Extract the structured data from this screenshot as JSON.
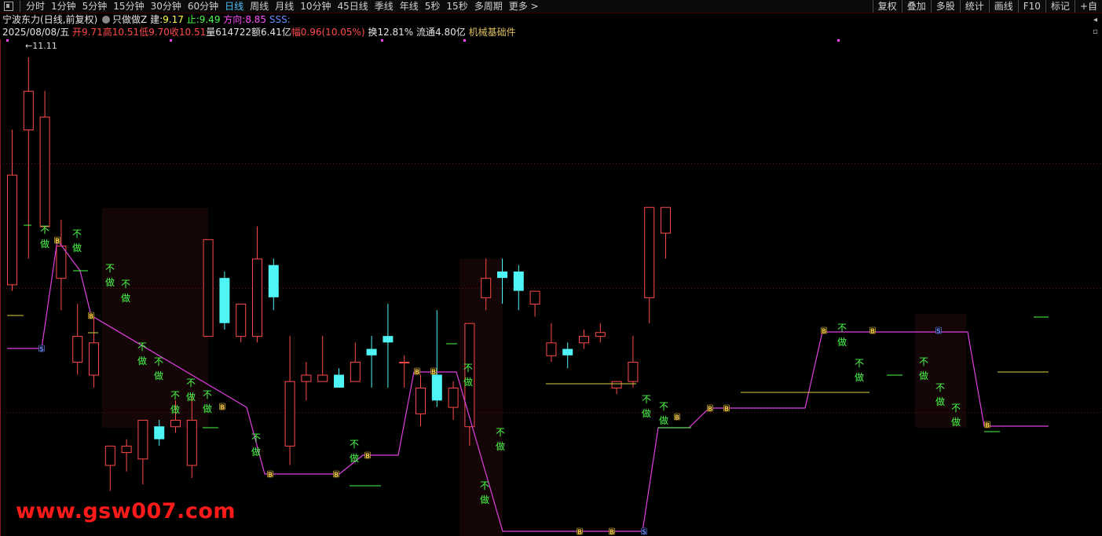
{
  "toolbar": {
    "periods": [
      "分时",
      "1分钟",
      "5分钟",
      "15分钟",
      "30分钟",
      "60分钟",
      "日线",
      "周线",
      "月线",
      "10分钟",
      "45日线",
      "季线",
      "年线",
      "5秒",
      "15秒",
      "多周期",
      "更多 >"
    ],
    "active_period": "日线",
    "right_buttons": [
      "复权",
      "叠加",
      "多股",
      "统计",
      "画线",
      "F10",
      "标记",
      "+自"
    ]
  },
  "info": {
    "stock_name": "宁波东力",
    "mode": "(日线,前复权)",
    "indicator_name": "只做做Z",
    "build_label": "建:",
    "build_value": "9.17",
    "stop_label": "止:",
    "stop_value": "9.49",
    "direction_label": "方向:",
    "direction_value": "8.85",
    "sss": "SSS:"
  },
  "quote": {
    "date": "2025/08/08/五",
    "open": "开9.71",
    "high": "高10.51",
    "low": "低9.70",
    "close": "收10.51",
    "volume": "量614722",
    "amount": "额6.41亿",
    "change": "幅0.96(10.05%)",
    "turnover": "换12.81%",
    "float": "流通4.80亿",
    "sector": "机械基础件"
  },
  "high_label": "11.11",
  "watermark": "www.gsw007.com",
  "signal_text": "不做",
  "signal_b": "B",
  "signal_s": "S",
  "colors": {
    "up": "#ff4a4a",
    "down": "#4ff5f5",
    "signal_green": "#4aff4a",
    "signal_yellow": "#ffd040",
    "trend_magenta": "#e040e0",
    "blue": "#6b8cff",
    "background": "#000000"
  },
  "chart_data": {
    "type": "candlestick",
    "ylim": [
      7.4,
      11.25
    ],
    "high_marker": 11.11,
    "candles": [
      {
        "o": 9.35,
        "h": 10.55,
        "l": 9.3,
        "c": 10.2
      },
      {
        "o": 10.55,
        "h": 11.11,
        "l": 9.55,
        "c": 10.85
      },
      {
        "o": 9.8,
        "h": 10.85,
        "l": 9.75,
        "c": 10.65
      },
      {
        "o": 9.4,
        "h": 9.85,
        "l": 9.15,
        "c": 9.65
      },
      {
        "o": 8.75,
        "h": 9.2,
        "l": 8.65,
        "c": 8.95
      },
      {
        "o": 8.65,
        "h": 9.1,
        "l": 8.55,
        "c": 8.9
      },
      {
        "o": 7.95,
        "h": 8.1,
        "l": 7.75,
        "c": 8.1
      },
      {
        "o": 8.05,
        "h": 8.15,
        "l": 7.9,
        "c": 8.1
      },
      {
        "o": 8.0,
        "h": 8.3,
        "l": 7.8,
        "c": 8.3
      },
      {
        "o": 8.25,
        "h": 8.3,
        "l": 8.1,
        "c": 8.15
      },
      {
        "o": 8.25,
        "h": 8.45,
        "l": 8.2,
        "c": 8.3
      },
      {
        "o": 7.95,
        "h": 8.5,
        "l": 7.85,
        "c": 8.3
      },
      {
        "o": 8.95,
        "h": 9.7,
        "l": 8.95,
        "c": 9.7
      },
      {
        "o": 9.4,
        "h": 9.45,
        "l": 9.0,
        "c": 9.05
      },
      {
        "o": 8.95,
        "h": 9.2,
        "l": 8.9,
        "c": 9.2
      },
      {
        "o": 8.95,
        "h": 9.8,
        "l": 8.9,
        "c": 9.55
      },
      {
        "o": 9.5,
        "h": 9.55,
        "l": 9.15,
        "c": 9.25
      },
      {
        "o": 8.1,
        "h": 8.95,
        "l": 7.95,
        "c": 8.6
      },
      {
        "o": 8.6,
        "h": 8.75,
        "l": 8.45,
        "c": 8.65
      },
      {
        "o": 8.6,
        "h": 8.95,
        "l": 8.6,
        "c": 8.65
      },
      {
        "o": 8.65,
        "h": 8.7,
        "l": 8.55,
        "c": 8.55
      },
      {
        "o": 8.6,
        "h": 8.9,
        "l": 8.6,
        "c": 8.75
      },
      {
        "o": 8.85,
        "h": 8.95,
        "l": 8.55,
        "c": 8.8
      },
      {
        "o": 8.95,
        "h": 9.2,
        "l": 8.55,
        "c": 8.9
      },
      {
        "o": 8.75,
        "h": 8.8,
        "l": 8.55,
        "c": 8.75
      },
      {
        "o": 8.35,
        "h": 8.65,
        "l": 8.25,
        "c": 8.55
      },
      {
        "o": 8.65,
        "h": 9.15,
        "l": 8.4,
        "c": 8.45
      },
      {
        "o": 8.4,
        "h": 8.6,
        "l": 8.3,
        "c": 8.55
      },
      {
        "o": 8.25,
        "h": 9.0,
        "l": 8.1,
        "c": 9.05
      },
      {
        "o": 9.25,
        "h": 9.55,
        "l": 9.15,
        "c": 9.4
      },
      {
        "o": 9.45,
        "h": 9.55,
        "l": 9.2,
        "c": 9.4
      },
      {
        "o": 9.45,
        "h": 9.5,
        "l": 9.15,
        "c": 9.3
      },
      {
        "o": 9.2,
        "h": 9.3,
        "l": 9.1,
        "c": 9.3
      },
      {
        "o": 8.8,
        "h": 9.05,
        "l": 8.75,
        "c": 8.9
      },
      {
        "o": 8.85,
        "h": 8.9,
        "l": 8.7,
        "c": 8.8
      },
      {
        "o": 8.9,
        "h": 9.0,
        "l": 8.85,
        "c": 8.95
      },
      {
        "o": 8.95,
        "h": 9.05,
        "l": 8.9,
        "c": 8.98
      },
      {
        "o": 8.55,
        "h": 8.6,
        "l": 8.5,
        "c": 8.6
      },
      {
        "o": 8.6,
        "h": 8.95,
        "l": 8.55,
        "c": 8.75
      },
      {
        "o": 9.25,
        "h": 9.9,
        "l": 9.05,
        "c": 9.95
      },
      {
        "o": 9.75,
        "h": 9.9,
        "l": 9.55,
        "c": 9.95
      }
    ]
  }
}
